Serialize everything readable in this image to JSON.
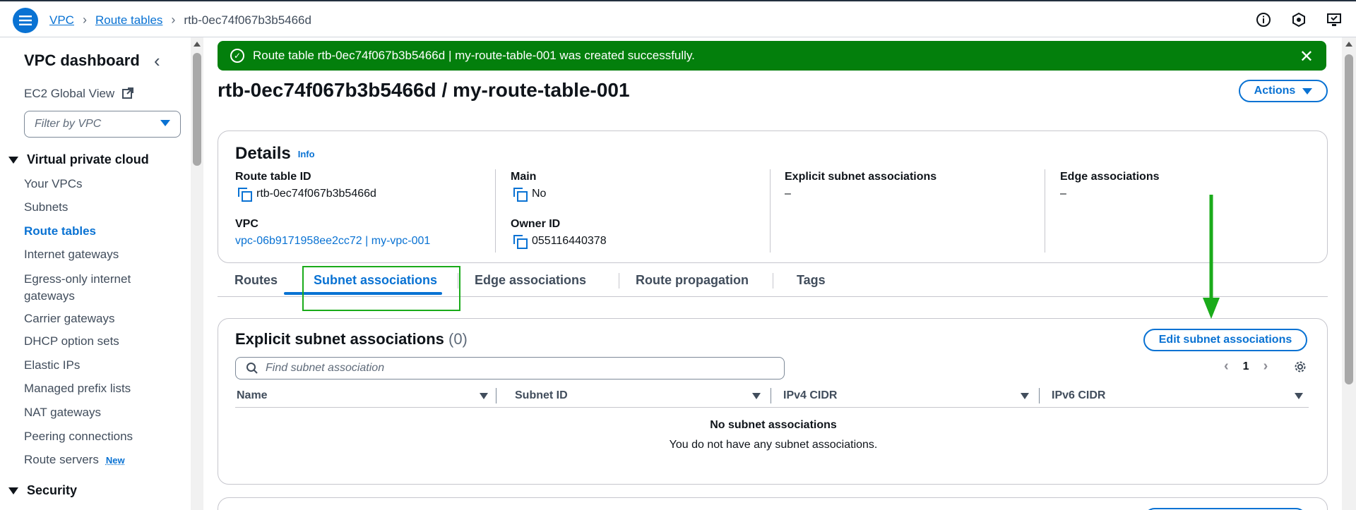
{
  "topbar": {
    "breadcrumbs": [
      "VPC",
      "Route tables"
    ],
    "current": "rtb-0ec74f067b3b5466d",
    "icons": [
      "info-icon",
      "notifications-icon",
      "feedback-icon"
    ]
  },
  "sidebar": {
    "title": "VPC dashboard",
    "global_view": "EC2 Global View",
    "filter_placeholder": "Filter by VPC",
    "section_vpc": "Virtual private cloud",
    "items": [
      {
        "label": "Your VPCs"
      },
      {
        "label": "Subnets"
      },
      {
        "label": "Route tables",
        "active": true
      },
      {
        "label": "Internet gateways"
      },
      {
        "label": "Egress-only internet gateways"
      },
      {
        "label": "Carrier gateways"
      },
      {
        "label": "DHCP option sets"
      },
      {
        "label": "Elastic IPs"
      },
      {
        "label": "Managed prefix lists"
      },
      {
        "label": "NAT gateways"
      },
      {
        "label": "Peering connections"
      },
      {
        "label": "Route servers",
        "badge": "New"
      }
    ],
    "section_security": "Security"
  },
  "flash": {
    "message": "Route table rtb-0ec74f067b3b5466d | my-route-table-001 was created successfully.",
    "color": "#037f0c"
  },
  "page": {
    "title": "rtb-0ec74f067b3b5466d / my-route-table-001",
    "actions_label": "Actions"
  },
  "details": {
    "heading": "Details",
    "info": "Info",
    "route_table_id_label": "Route table ID",
    "route_table_id": "rtb-0ec74f067b3b5466d",
    "main_label": "Main",
    "main_value": "No",
    "explicit_label": "Explicit subnet associations",
    "explicit_value": "–",
    "edge_label": "Edge associations",
    "edge_value": "–",
    "vpc_label": "VPC",
    "vpc_value": "vpc-06b9171958ee2cc72 | my-vpc-001",
    "owner_label": "Owner ID",
    "owner_value": "055116440378"
  },
  "tabs": [
    "Routes",
    "Subnet associations",
    "Edge associations",
    "Route propagation",
    "Tags"
  ],
  "active_tab": "Subnet associations",
  "explicit": {
    "heading": "Explicit subnet associations",
    "count": "(0)",
    "edit_label": "Edit subnet associations",
    "search_placeholder": "Find subnet association",
    "page": "1",
    "columns": [
      "Name",
      "Subnet ID",
      "IPv4 CIDR",
      "IPv6 CIDR"
    ],
    "empty_title": "No subnet associations",
    "empty_sub": "You do not have any subnet associations."
  },
  "colors": {
    "accent": "#0972d3",
    "success": "#037f0c",
    "annotation": "#1aab1a"
  }
}
